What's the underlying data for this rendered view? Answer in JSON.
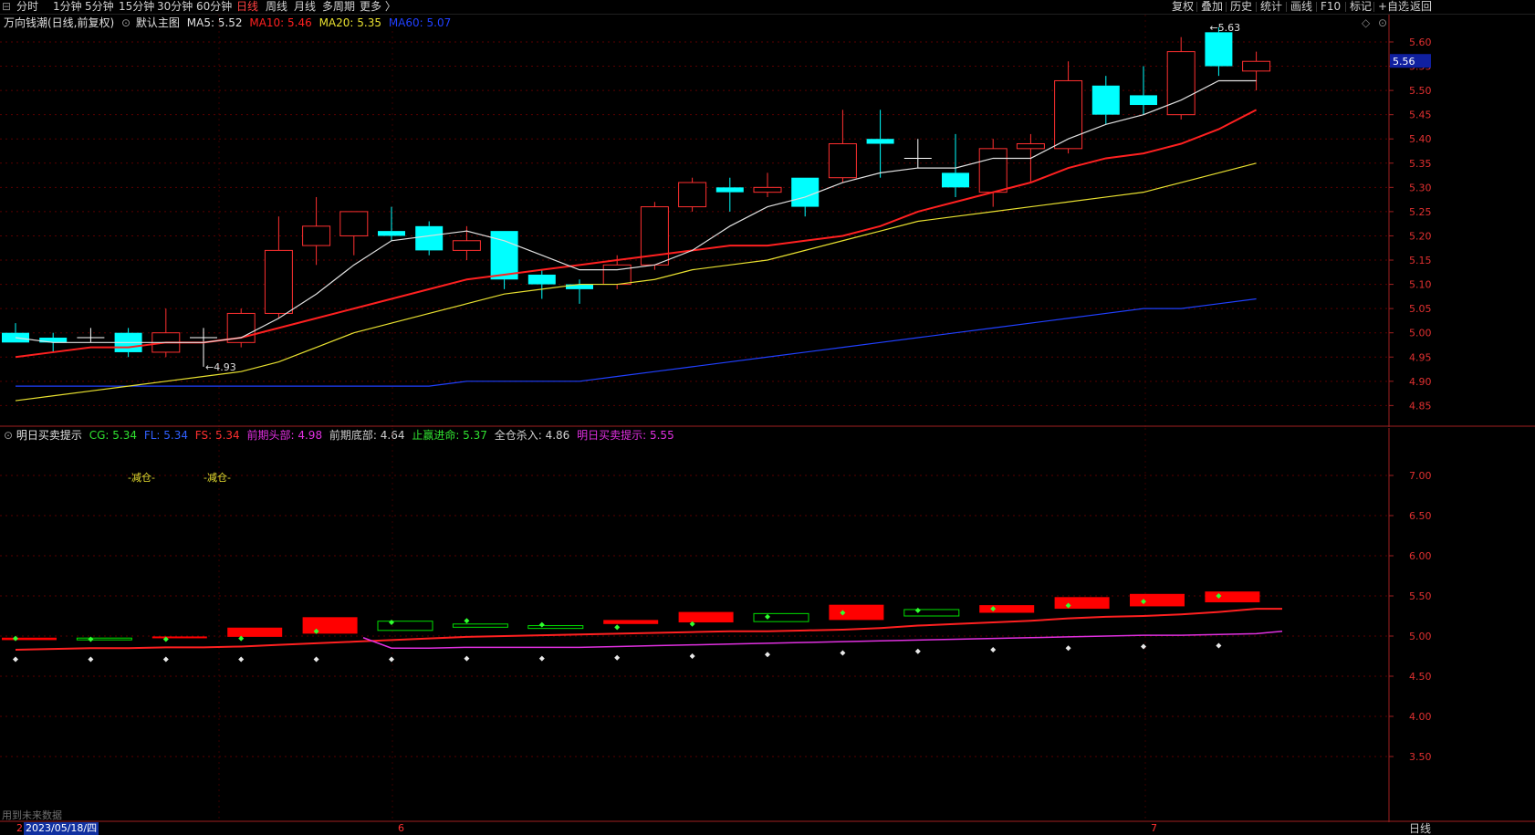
{
  "toolbar": {
    "left_items": [
      {
        "label": "分时",
        "active": false
      },
      {
        "label": "1分钟",
        "active": false
      },
      {
        "label": "5分钟",
        "active": false
      },
      {
        "label": "15分钟",
        "active": false
      },
      {
        "label": "30分钟",
        "active": false
      },
      {
        "label": "60分钟",
        "active": false
      },
      {
        "label": "日线",
        "active": true
      },
      {
        "label": "周线",
        "active": false
      },
      {
        "label": "月线",
        "active": false
      },
      {
        "label": "多周期",
        "active": false
      },
      {
        "label": "更多 〉",
        "active": false
      }
    ],
    "right_items": [
      "复权",
      "叠加",
      "历史",
      "统计",
      "画线",
      "F10",
      "标记",
      "+自选",
      "返回"
    ]
  },
  "main_chart": {
    "stock_title": "万向钱潮(日线,前复权)",
    "template_label": "默认主图",
    "ma": [
      {
        "label": "MA5:",
        "value": "5.52",
        "color": "#e0e0e0"
      },
      {
        "label": "MA10:",
        "value": "5.46",
        "color": "#ff2020"
      },
      {
        "label": "MA20:",
        "value": "5.35",
        "color": "#e8e030"
      },
      {
        "label": "MA60:",
        "value": "5.07",
        "color": "#2040ff"
      }
    ],
    "current_price_badge": "5.56",
    "high_marker": "5.63",
    "low_marker": "4.93",
    "y_ticks": [
      "5.60",
      "5.55",
      "5.50",
      "5.45",
      "5.40",
      "5.35",
      "5.30",
      "5.25",
      "5.20",
      "5.15",
      "5.10",
      "5.05",
      "5.00",
      "4.95",
      "4.90",
      "4.85"
    ]
  },
  "indicator": {
    "name": "明日买卖提示",
    "fields": [
      {
        "label": "CG:",
        "value": "5.34",
        "color": "#30e030"
      },
      {
        "label": "FL:",
        "value": "5.34",
        "color": "#3060ff"
      },
      {
        "label": "FS:",
        "value": "5.34",
        "color": "#ff3030"
      },
      {
        "label": "前期头部:",
        "value": "4.98",
        "color": "#e030e0"
      },
      {
        "label": "前期底部:",
        "value": "4.64",
        "color": "#d0d0d0"
      },
      {
        "label": "止赢进命:",
        "value": "5.37",
        "color": "#30e030"
      },
      {
        "label": "全仓杀入:",
        "value": "4.86",
        "color": "#d0d0d0"
      },
      {
        "label": "明日买卖提示:",
        "value": "5.55",
        "color": "#e030e0"
      }
    ],
    "signal_labels": [
      "-减仓-",
      "-减仓-"
    ],
    "y_ticks": [
      "7.00",
      "6.50",
      "6.00",
      "5.50",
      "5.00",
      "4.50",
      "4.00",
      "3.50"
    ],
    "future_data_note": "用到未来数据"
  },
  "bottom": {
    "date_badge": "2023/05/18/四",
    "month_markers": [
      "2",
      "6",
      "7"
    ],
    "period_button": "日线"
  },
  "chart_data": {
    "type": "candlestick",
    "candles": [
      {
        "o": 5.0,
        "h": 5.02,
        "l": 4.98,
        "c": 4.98
      },
      {
        "o": 4.99,
        "h": 5.0,
        "l": 4.96,
        "c": 4.98
      },
      {
        "o": 4.99,
        "h": 5.01,
        "l": 4.98,
        "c": 4.99
      },
      {
        "o": 5.0,
        "h": 5.01,
        "l": 4.95,
        "c": 4.96
      },
      {
        "o": 4.96,
        "h": 5.05,
        "l": 4.95,
        "c": 5.0
      },
      {
        "o": 4.99,
        "h": 5.01,
        "l": 4.93,
        "c": 4.99
      },
      {
        "o": 4.98,
        "h": 5.05,
        "l": 4.97,
        "c": 5.04
      },
      {
        "o": 5.04,
        "h": 5.24,
        "l": 5.03,
        "c": 5.17
      },
      {
        "o": 5.18,
        "h": 5.28,
        "l": 5.14,
        "c": 5.22
      },
      {
        "o": 5.2,
        "h": 5.25,
        "l": 5.16,
        "c": 5.25
      },
      {
        "o": 5.21,
        "h": 5.26,
        "l": 5.19,
        "c": 5.2
      },
      {
        "o": 5.22,
        "h": 5.23,
        "l": 5.16,
        "c": 5.17
      },
      {
        "o": 5.17,
        "h": 5.22,
        "l": 5.15,
        "c": 5.19
      },
      {
        "o": 5.21,
        "h": 5.21,
        "l": 5.09,
        "c": 5.11
      },
      {
        "o": 5.12,
        "h": 5.13,
        "l": 5.07,
        "c": 5.1
      },
      {
        "o": 5.1,
        "h": 5.11,
        "l": 5.06,
        "c": 5.09
      },
      {
        "o": 5.1,
        "h": 5.16,
        "l": 5.09,
        "c": 5.14
      },
      {
        "o": 5.14,
        "h": 5.27,
        "l": 5.13,
        "c": 5.26
      },
      {
        "o": 5.26,
        "h": 5.32,
        "l": 5.25,
        "c": 5.31
      },
      {
        "o": 5.3,
        "h": 5.32,
        "l": 5.25,
        "c": 5.29
      },
      {
        "o": 5.29,
        "h": 5.33,
        "l": 5.28,
        "c": 5.3
      },
      {
        "o": 5.32,
        "h": 5.32,
        "l": 5.24,
        "c": 5.26
      },
      {
        "o": 5.32,
        "h": 5.46,
        "l": 5.31,
        "c": 5.39
      },
      {
        "o": 5.4,
        "h": 5.46,
        "l": 5.32,
        "c": 5.39
      },
      {
        "o": 5.36,
        "h": 5.4,
        "l": 5.34,
        "c": 5.36
      },
      {
        "o": 5.33,
        "h": 5.41,
        "l": 5.28,
        "c": 5.3
      },
      {
        "o": 5.29,
        "h": 5.4,
        "l": 5.26,
        "c": 5.38
      },
      {
        "o": 5.38,
        "h": 5.41,
        "l": 5.31,
        "c": 5.39
      },
      {
        "o": 5.38,
        "h": 5.56,
        "l": 5.37,
        "c": 5.52
      },
      {
        "o": 5.51,
        "h": 5.53,
        "l": 5.43,
        "c": 5.45
      },
      {
        "o": 5.49,
        "h": 5.55,
        "l": 5.45,
        "c": 5.47
      },
      {
        "o": 5.45,
        "h": 5.61,
        "l": 5.44,
        "c": 5.58
      },
      {
        "o": 5.62,
        "h": 5.63,
        "l": 5.53,
        "c": 5.55
      },
      {
        "o": 5.54,
        "h": 5.58,
        "l": 5.5,
        "c": 5.56
      }
    ],
    "ma5": [
      4.99,
      4.98,
      4.98,
      4.98,
      4.98,
      4.98,
      4.99,
      5.03,
      5.08,
      5.14,
      5.19,
      5.2,
      5.21,
      5.19,
      5.16,
      5.13,
      5.13,
      5.14,
      5.17,
      5.22,
      5.26,
      5.28,
      5.31,
      5.33,
      5.34,
      5.34,
      5.36,
      5.36,
      5.4,
      5.43,
      5.45,
      5.48,
      5.52,
      5.52
    ],
    "ma10": [
      4.95,
      4.96,
      4.97,
      4.97,
      4.98,
      4.98,
      4.99,
      5.01,
      5.03,
      5.05,
      5.07,
      5.09,
      5.11,
      5.12,
      5.13,
      5.14,
      5.15,
      5.16,
      5.17,
      5.18,
      5.18,
      5.19,
      5.2,
      5.22,
      5.25,
      5.27,
      5.29,
      5.31,
      5.34,
      5.36,
      5.37,
      5.39,
      5.42,
      5.46
    ],
    "ma20": [
      4.86,
      4.87,
      4.88,
      4.89,
      4.9,
      4.91,
      4.92,
      4.94,
      4.97,
      5.0,
      5.02,
      5.04,
      5.06,
      5.08,
      5.09,
      5.1,
      5.1,
      5.11,
      5.13,
      5.14,
      5.15,
      5.17,
      5.19,
      5.21,
      5.23,
      5.24,
      5.25,
      5.26,
      5.27,
      5.28,
      5.29,
      5.31,
      5.33,
      5.35
    ],
    "ma60": [
      4.89,
      4.89,
      4.89,
      4.89,
      4.89,
      4.89,
      4.89,
      4.89,
      4.89,
      4.89,
      4.89,
      4.89,
      4.9,
      4.9,
      4.9,
      4.9,
      4.91,
      4.92,
      4.93,
      4.94,
      4.95,
      4.96,
      4.97,
      4.98,
      4.99,
      5.0,
      5.01,
      5.02,
      5.03,
      5.04,
      5.05,
      5.05,
      5.06,
      5.07
    ],
    "y_range": [
      4.83,
      5.64
    ]
  }
}
